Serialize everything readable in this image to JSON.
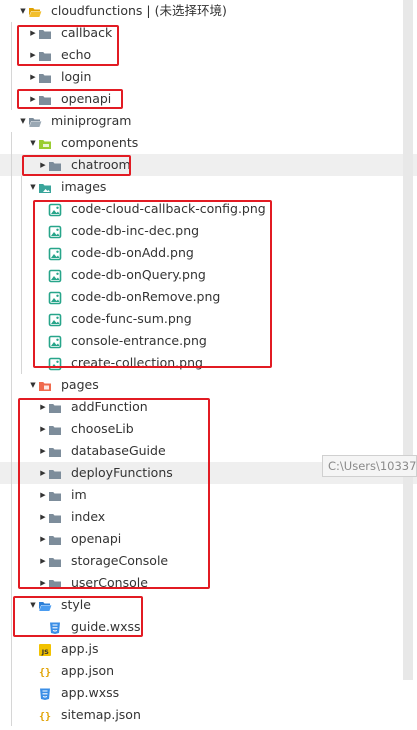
{
  "tree": [
    {
      "label": "cloudfunctions | (未选择环境)",
      "depth": 0,
      "chevron": "down",
      "icon": "folder-cloud",
      "icon_name": "cloud-folder-icon"
    },
    {
      "label": "callback",
      "depth": 1,
      "chevron": "right",
      "icon": "folder",
      "icon_name": "folder-icon"
    },
    {
      "label": "echo",
      "depth": 1,
      "chevron": "right",
      "icon": "folder",
      "icon_name": "folder-icon"
    },
    {
      "label": "login",
      "depth": 1,
      "chevron": "right",
      "icon": "folder",
      "icon_name": "folder-icon"
    },
    {
      "label": "openapi",
      "depth": 1,
      "chevron": "right",
      "icon": "folder",
      "icon_name": "folder-icon"
    },
    {
      "label": "miniprogram",
      "depth": 0,
      "chevron": "down",
      "icon": "folder-open",
      "icon_name": "folder-open-icon"
    },
    {
      "label": "components",
      "depth": 1,
      "chevron": "down",
      "icon": "folder-components",
      "icon_name": "components-folder-icon"
    },
    {
      "label": "chatroom",
      "depth": 2,
      "chevron": "right",
      "icon": "folder",
      "icon_name": "folder-icon",
      "highlight": true
    },
    {
      "label": "images",
      "depth": 1,
      "chevron": "down",
      "icon": "folder-images",
      "icon_name": "images-folder-icon"
    },
    {
      "label": "code-cloud-callback-config.png",
      "depth": 2,
      "icon": "png",
      "icon_name": "image-file-icon"
    },
    {
      "label": "code-db-inc-dec.png",
      "depth": 2,
      "icon": "png",
      "icon_name": "image-file-icon"
    },
    {
      "label": "code-db-onAdd.png",
      "depth": 2,
      "icon": "png",
      "icon_name": "image-file-icon"
    },
    {
      "label": "code-db-onQuery.png",
      "depth": 2,
      "icon": "png",
      "icon_name": "image-file-icon"
    },
    {
      "label": "code-db-onRemove.png",
      "depth": 2,
      "icon": "png",
      "icon_name": "image-file-icon"
    },
    {
      "label": "code-func-sum.png",
      "depth": 2,
      "icon": "png",
      "icon_name": "image-file-icon"
    },
    {
      "label": "console-entrance.png",
      "depth": 2,
      "icon": "png",
      "icon_name": "image-file-icon"
    },
    {
      "label": "create-collection.png",
      "depth": 2,
      "icon": "png",
      "icon_name": "image-file-icon"
    },
    {
      "label": "pages",
      "depth": 1,
      "chevron": "down",
      "icon": "folder-pages",
      "icon_name": "pages-folder-icon"
    },
    {
      "label": "addFunction",
      "depth": 2,
      "chevron": "right",
      "icon": "folder",
      "icon_name": "folder-icon"
    },
    {
      "label": "chooseLib",
      "depth": 2,
      "chevron": "right",
      "icon": "folder",
      "icon_name": "folder-icon"
    },
    {
      "label": "databaseGuide",
      "depth": 2,
      "chevron": "right",
      "icon": "folder",
      "icon_name": "folder-icon"
    },
    {
      "label": "deployFunctions",
      "depth": 2,
      "chevron": "right",
      "icon": "folder",
      "icon_name": "folder-icon",
      "highlight": true
    },
    {
      "label": "im",
      "depth": 2,
      "chevron": "right",
      "icon": "folder",
      "icon_name": "folder-icon"
    },
    {
      "label": "index",
      "depth": 2,
      "chevron": "right",
      "icon": "folder",
      "icon_name": "folder-icon"
    },
    {
      "label": "openapi",
      "depth": 2,
      "chevron": "right",
      "icon": "folder",
      "icon_name": "folder-icon"
    },
    {
      "label": "storageConsole",
      "depth": 2,
      "chevron": "right",
      "icon": "folder",
      "icon_name": "folder-icon"
    },
    {
      "label": "userConsole",
      "depth": 2,
      "chevron": "right",
      "icon": "folder",
      "icon_name": "folder-icon"
    },
    {
      "label": "style",
      "depth": 1,
      "chevron": "down",
      "icon": "folder-style",
      "icon_name": "style-folder-icon"
    },
    {
      "label": "guide.wxss",
      "depth": 2,
      "icon": "wxss",
      "icon_name": "wxss-file-icon"
    },
    {
      "label": "app.js",
      "depth": 1,
      "icon": "js",
      "icon_name": "js-file-icon"
    },
    {
      "label": "app.json",
      "depth": 1,
      "icon": "json",
      "icon_name": "json-file-icon"
    },
    {
      "label": "app.wxss",
      "depth": 1,
      "icon": "wxss",
      "icon_name": "wxss-file-icon"
    },
    {
      "label": "sitemap.json",
      "depth": 1,
      "icon": "json",
      "icon_name": "json-file-icon"
    }
  ],
  "tooltip": "C:\\Users\\10337",
  "colors": {
    "annotation": "#e21b23",
    "folder": "#7a8b99",
    "highlight": "#efefef"
  }
}
